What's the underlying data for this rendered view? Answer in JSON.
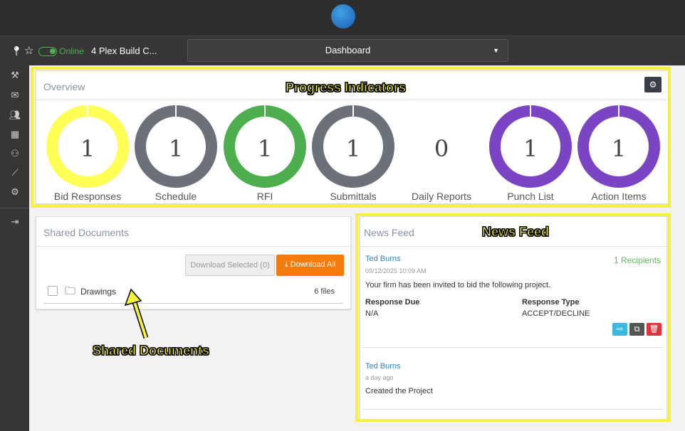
{
  "header": {
    "project": "4 Plex Build C...",
    "status": "Online",
    "view_select": "Dashboard"
  },
  "sidebar": {
    "items": [
      "hammer-icon",
      "mail-icon",
      "team-icon",
      "calendar-icon",
      "contacts-icon",
      "chart-icon",
      "settings-icon",
      "logout-icon"
    ]
  },
  "overview": {
    "title": "Overview",
    "indicators": [
      {
        "label": "Bid Responses",
        "value": "1",
        "color": "#ffff55"
      },
      {
        "label": "Schedule",
        "value": "1",
        "color": "#6b7079"
      },
      {
        "label": "RFI",
        "value": "1",
        "color": "#4cae4c"
      },
      {
        "label": "Submittals",
        "value": "1",
        "color": "#6b7079"
      },
      {
        "label": "Daily Reports",
        "value": "0",
        "color": null
      },
      {
        "label": "Punch List",
        "value": "1",
        "color": "#7a44c4"
      },
      {
        "label": "Action Items",
        "value": "1",
        "color": "#7a44c4"
      }
    ]
  },
  "shared_docs": {
    "title": "Shared Documents",
    "download_selected": "Download Selected (0)",
    "download_all": "Download All",
    "folders": [
      {
        "name": "Drawings",
        "count": "6 files"
      }
    ]
  },
  "news_feed": {
    "title": "News Feed",
    "items": [
      {
        "author": "Ted Burns",
        "recipients": "1 Recipients",
        "time": "09/12/2025 10:09 AM",
        "text": "Your firm has been invited to bid the following project.",
        "due_label": "Response Due",
        "due_value": "N/A",
        "type_label": "Response Type",
        "type_value": "ACCEPT/DECLINE"
      },
      {
        "author": "Ted Burns",
        "time": "a day ago",
        "text": "Created the Project"
      }
    ]
  },
  "annotations": {
    "progress": "Progress Indicators",
    "news": "News Feed",
    "shared": "Shared Documents"
  }
}
